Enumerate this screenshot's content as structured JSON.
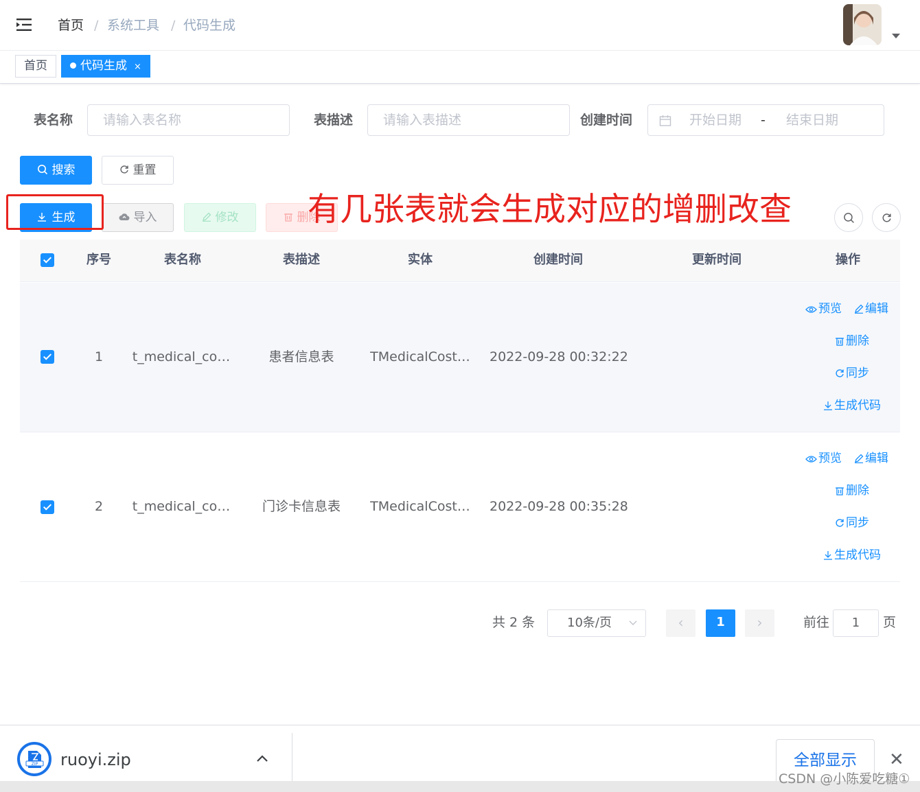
{
  "navbar": {
    "breadcrumb": [
      "首页",
      "系统工具",
      "代码生成"
    ],
    "separator": "/"
  },
  "tags": {
    "home": "首页",
    "active": "代码生成",
    "close": "×"
  },
  "search": {
    "table_name_label": "表名称",
    "table_name_placeholder": "请输入表名称",
    "table_desc_label": "表描述",
    "table_desc_placeholder": "请输入表描述",
    "create_time_label": "创建时间",
    "start_placeholder": "开始日期",
    "range_sep": "-",
    "end_placeholder": "结束日期",
    "search_btn": "搜索",
    "reset_btn": "重置"
  },
  "toolbar": {
    "generate": "生成",
    "import": "导入",
    "edit": "修改",
    "delete": "删除"
  },
  "annotation": "有几张表就会生成对应的增删改查",
  "table": {
    "headers": [
      "序号",
      "表名称",
      "表描述",
      "实体",
      "创建时间",
      "更新时间",
      "操作"
    ],
    "rows": [
      {
        "index": "1",
        "name": "t_medical_co…",
        "desc": "患者信息表",
        "entity": "TMedicalCost…",
        "created": "2022-09-28 00:32:22",
        "updated": ""
      },
      {
        "index": "2",
        "name": "t_medical_co…",
        "desc": "门诊卡信息表",
        "entity": "TMedicalCost…",
        "created": "2022-09-28 00:35:28",
        "updated": ""
      }
    ],
    "ops": {
      "preview": "预览",
      "edit": "编辑",
      "delete": "删除",
      "sync": "同步",
      "gen": "生成代码"
    }
  },
  "pagination": {
    "total": "共 2 条",
    "page_size": "10条/页",
    "current": "1",
    "goto_prefix": "前往",
    "goto_value": "1",
    "goto_suffix": "页"
  },
  "download_bar": {
    "file": "ruoyi.zip",
    "show_all": "全部显示",
    "close": "✕"
  },
  "watermark": "CSDN @小陈爱吃糖①",
  "colors": {
    "primary": "#1890ff",
    "annotation": "#e8231e"
  }
}
